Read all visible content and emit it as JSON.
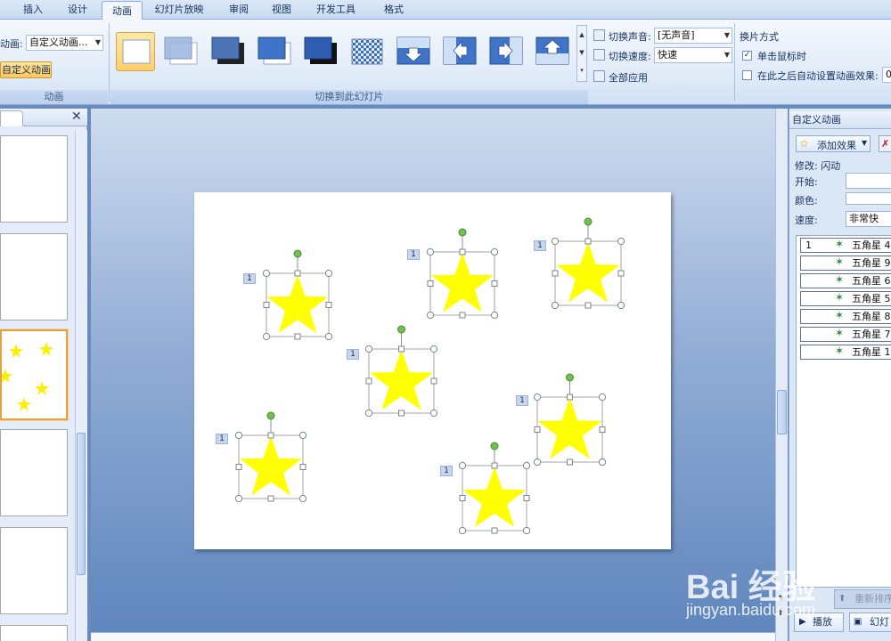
{
  "tabs": [
    "插入",
    "设计",
    "动画",
    "幻灯片放映",
    "审阅",
    "视图",
    "开发工具",
    "格式"
  ],
  "active_tab": "动画",
  "animation_group": {
    "anim_label": "动画:",
    "anim_value": "自定义动画...",
    "custom_button": "自定义动画",
    "group_name": "动画"
  },
  "transition_group": {
    "group_name": "切换到此幻灯片",
    "sound_label": "切换声音:",
    "sound_value": "[无声音]",
    "speed_label": "切换速度:",
    "speed_value": "快速",
    "apply_all": "全部应用"
  },
  "advance_group": {
    "title": "换片方式",
    "on_click": "单击鼠标时",
    "auto_after": "在此之后自动设置动画效果:",
    "auto_value": "0"
  },
  "task_pane": {
    "title": "自定义动画",
    "add_effect": "添加效果",
    "modify": "修改: 闪动",
    "start_label": "开始:",
    "start_value": "",
    "color_label": "颜色:",
    "speed_label": "速度:",
    "speed_value": "非常快",
    "items": [
      {
        "index": "1",
        "name": "五角星 4"
      },
      {
        "index": "",
        "name": "五角星 9"
      },
      {
        "index": "",
        "name": "五角星 6"
      },
      {
        "index": "",
        "name": "五角星 5"
      },
      {
        "index": "",
        "name": "五角星 8"
      },
      {
        "index": "",
        "name": "五角星 7"
      },
      {
        "index": "",
        "name": "五角星 1"
      }
    ],
    "reorder": "重新排序",
    "play": "播放",
    "slideshow": "幻灯"
  },
  "slide": {
    "star_color": "#ffff00",
    "markers": [
      "1",
      "1",
      "1",
      "1",
      "1",
      "1",
      "1"
    ]
  },
  "watermark": {
    "line1": "Bai 经验",
    "line2": "jingyan.baidu.com"
  },
  "colors": {
    "accent_tab": "#f3f7fd",
    "selection_orange": "#ffc75a",
    "star": "#ffff00",
    "handle": "#70c050"
  }
}
